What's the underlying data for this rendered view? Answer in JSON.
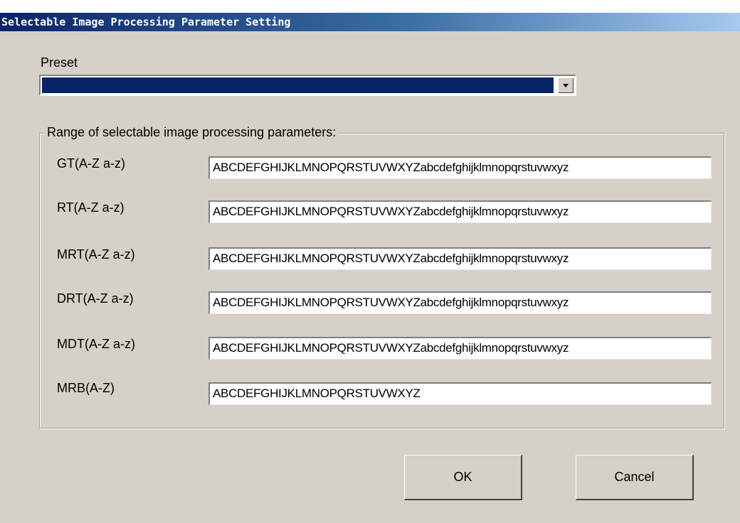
{
  "window": {
    "title": "Selectable Image Processing Parameter Setting"
  },
  "preset": {
    "label": "Preset",
    "selected_value": ""
  },
  "group": {
    "legend": "Range of selectable image processing parameters:"
  },
  "params": [
    {
      "label": "GT(A-Z a-z)",
      "value": "ABCDEFGHIJKLMNOPQRSTUVWXYZabcdefghijklmnopqrstuvwxyz"
    },
    {
      "label": "RT(A-Z a-z)",
      "value": "ABCDEFGHIJKLMNOPQRSTUVWXYZabcdefghijklmnopqrstuvwxyz"
    },
    {
      "label": "MRT(A-Z a-z)",
      "value": "ABCDEFGHIJKLMNOPQRSTUVWXYZabcdefghijklmnopqrstuvwxyz"
    },
    {
      "label": "DRT(A-Z a-z)",
      "value": "ABCDEFGHIJKLMNOPQRSTUVWXYZabcdefghijklmnopqrstuvwxyz"
    },
    {
      "label": "MDT(A-Z a-z)",
      "value": "ABCDEFGHIJKLMNOPQRSTUVWXYZabcdefghijklmnopqrstuvwxyz"
    },
    {
      "label": "MRB(A-Z)",
      "value": "ABCDEFGHIJKLMNOPQRSTUVWXYZ"
    }
  ],
  "buttons": {
    "ok_label": "OK",
    "cancel_label": "Cancel"
  },
  "colors": {
    "title_bar": "#0a246a",
    "dialog_background": "#d5d0c8",
    "selection_highlight": "#0a246a"
  },
  "icons": {
    "dropdown": "chevron-down-icon"
  }
}
